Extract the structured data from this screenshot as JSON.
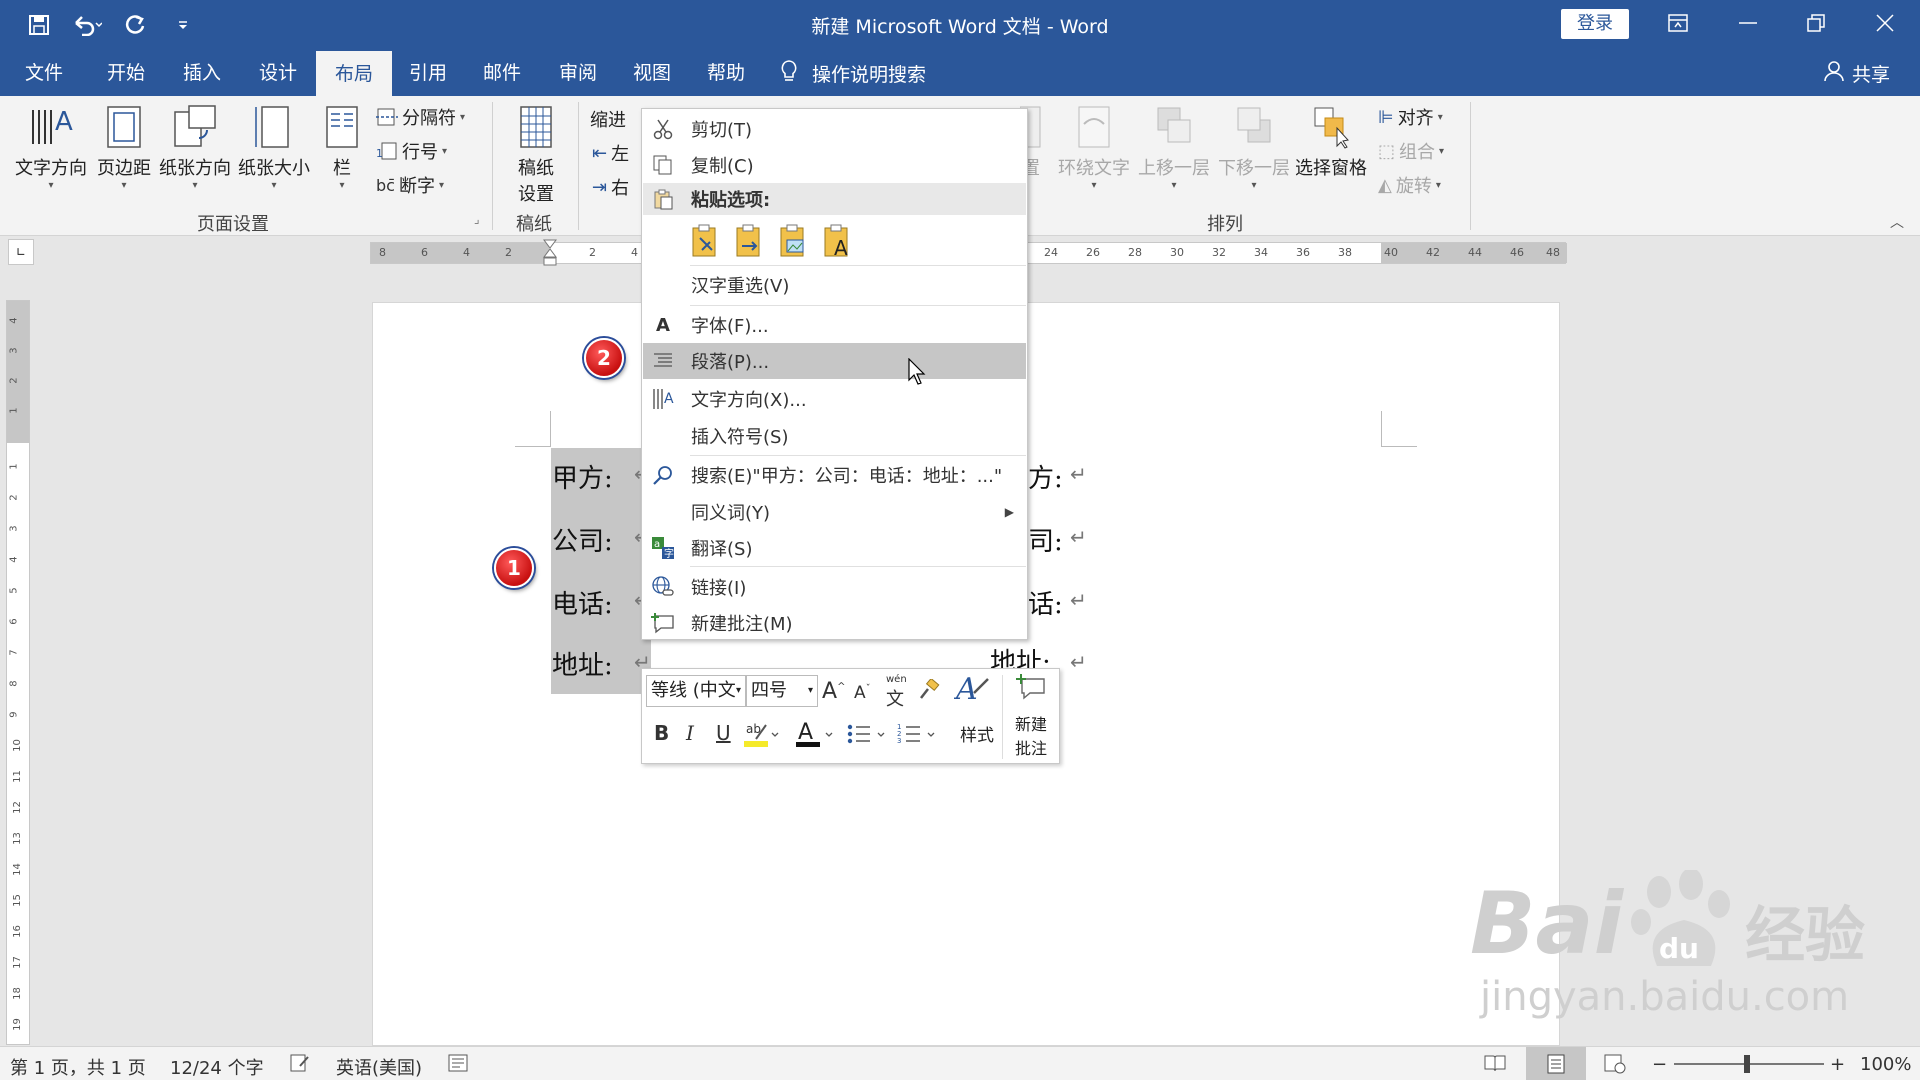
{
  "window": {
    "title": "新建 Microsoft Word 文档  -  Word",
    "login_label": "登录",
    "colors": {
      "brand": "#2b579a",
      "ribbon_bg": "#f3f3f3",
      "callout": "#d42020"
    }
  },
  "tabs": [
    "文件",
    "开始",
    "插入",
    "设计",
    "布局",
    "引用",
    "邮件",
    "审阅",
    "视图",
    "帮助"
  ],
  "active_tab": "布局",
  "search_label": "操作说明搜索",
  "share_label": "共享",
  "ribbon": {
    "page_setup": {
      "text_direction": "文字方向",
      "margins": "页边距",
      "orientation": "纸张方向",
      "size": "纸张大小",
      "columns": "栏",
      "breaks": "分隔符",
      "line_numbers": "行号",
      "hyphenation": "断字",
      "group_label": "页面设置"
    },
    "draft": {
      "settings_line1": "稿纸",
      "settings_line2": "设置",
      "group_label": "稿纸"
    },
    "paragraph": {
      "indent_label": "缩进",
      "left": "左",
      "right": "右"
    },
    "arrange": {
      "position_partial": "置",
      "wrap_text": "环绕文字",
      "bring_forward": "上移一层",
      "send_backward": "下移一层",
      "selection_pane": "选择窗格",
      "align": "对齐",
      "group": "组合",
      "rotate": "旋转",
      "group_label": "排列"
    }
  },
  "ruler": {
    "left_ticks": [
      "8",
      "6",
      "4",
      "2"
    ],
    "right_ticks": [
      "2",
      "4"
    ],
    "far_ticks": [
      "24",
      "26",
      "28",
      "30",
      "32",
      "34",
      "36",
      "38",
      "40",
      "42",
      "44",
      "46",
      "48"
    ],
    "v_top": [
      "4",
      "3",
      "2",
      "1"
    ],
    "v_ticks": [
      "1",
      "2",
      "3",
      "4",
      "5",
      "6",
      "7",
      "8",
      "9",
      "10",
      "11",
      "12",
      "13",
      "14",
      "15",
      "16",
      "17",
      "18",
      "19"
    ]
  },
  "document": {
    "left_lines": [
      "甲方:",
      "公司:",
      "电话:",
      "地址:"
    ],
    "right_lines": [
      "方:",
      "司:",
      "话:",
      "地址:"
    ],
    "para_mark": "↵"
  },
  "context_menu": {
    "cut": "剪切(T)",
    "copy": "复制(C)",
    "paste_options": "粘贴选项:",
    "reconvert": "汉字重选(V)",
    "font": "字体(F)...",
    "paragraph": "段落(P)...",
    "text_direction": "文字方向(X)...",
    "insert_symbol": "插入符号(S)",
    "search": "搜索(E)\"甲方：公司：电话：地址：...\"",
    "synonyms": "同义词(Y)",
    "translate": "翻译(S)",
    "link": "链接(I)",
    "new_comment": "新建批注(M)"
  },
  "mini_toolbar": {
    "font": "等线 (中文",
    "size": "四号",
    "styles": "样式",
    "new_comment_line1": "新建",
    "new_comment_line2": "批注",
    "wen": "wén"
  },
  "callouts": [
    "1",
    "2"
  ],
  "status": {
    "page": "第 1 页，共 1 页",
    "words": "12/24 个字",
    "language": "英语(美国)",
    "zoom": "100%"
  },
  "watermark": {
    "brand": "Bai",
    "brand2": "du",
    "cn": "经验",
    "url": "jingyan.baidu.com"
  }
}
